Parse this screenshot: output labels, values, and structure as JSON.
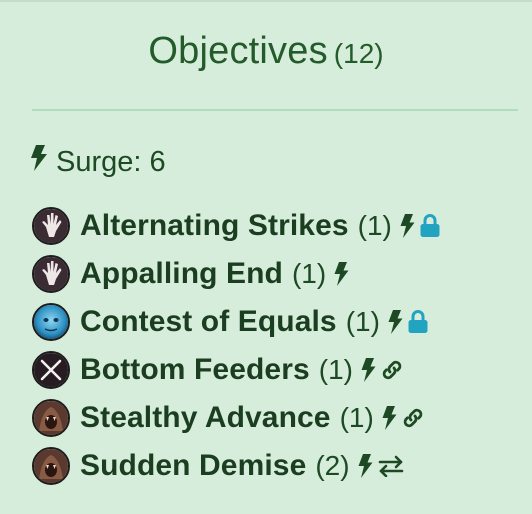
{
  "header": {
    "title": "Objectives",
    "count": "(12)"
  },
  "surge": {
    "label": "Surge:",
    "value": "6",
    "icon": "bolt-icon"
  },
  "colors": {
    "background": "#d7eddb",
    "title": "#245b2b",
    "text": "#1b3d20",
    "divider": "#b4dcbc",
    "lock": "#21a3c1"
  },
  "objectives": [
    {
      "name": "Alternating Strikes",
      "qty": "(1)",
      "avatar": "hand-icon",
      "icons": [
        "bolt-icon",
        "lock-icon"
      ]
    },
    {
      "name": "Appalling End",
      "qty": "(1)",
      "avatar": "hand-icon",
      "icons": [
        "bolt-icon"
      ]
    },
    {
      "name": "Contest of Equals",
      "qty": "(1)",
      "avatar": "blue-mask-icon",
      "icons": [
        "bolt-icon",
        "lock-icon"
      ]
    },
    {
      "name": "Bottom Feeders",
      "qty": "(1)",
      "avatar": "crossed-swords-icon",
      "icons": [
        "bolt-icon",
        "link-icon"
      ]
    },
    {
      "name": "Stealthy Advance",
      "qty": "(1)",
      "avatar": "beast-icon",
      "icons": [
        "bolt-icon",
        "link-icon"
      ]
    },
    {
      "name": "Sudden Demise",
      "qty": "(2)",
      "avatar": "beast-icon",
      "icons": [
        "bolt-icon",
        "swap-icon"
      ]
    }
  ]
}
